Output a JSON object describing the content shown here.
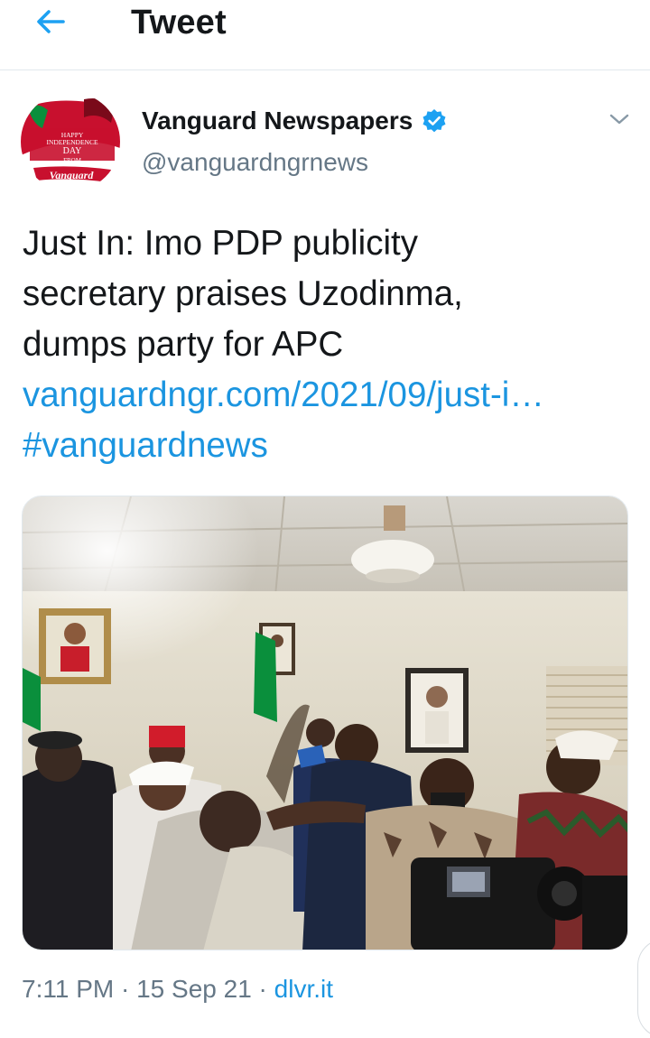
{
  "header": {
    "title": "Tweet",
    "back_icon": "arrow-left-icon"
  },
  "author": {
    "display_name": "Vanguard Newspapers",
    "handle": "@vanguardngrnews",
    "verified": true,
    "avatar_text": {
      "line1": "HAPPY",
      "line2": "INDEPENDENCE",
      "line3": "DAY",
      "line4": "FROM",
      "brand": "Vanguard"
    }
  },
  "tweet": {
    "text_lines": [
      "Just In: Imo PDP publicity",
      "secretary praises Uzodinma,",
      "dumps party for APC"
    ],
    "link": "vanguardngr.com/2021/09/just-i…",
    "hashtag": "#vanguardnews"
  },
  "meta": {
    "time": "7:11 PM",
    "separator": "·",
    "date": "15 Sep 21",
    "source": "dlvr.it"
  },
  "colors": {
    "accent": "#1b95e0",
    "text": "#14171a",
    "secondary": "#657786",
    "verified": "#1da1f2"
  }
}
